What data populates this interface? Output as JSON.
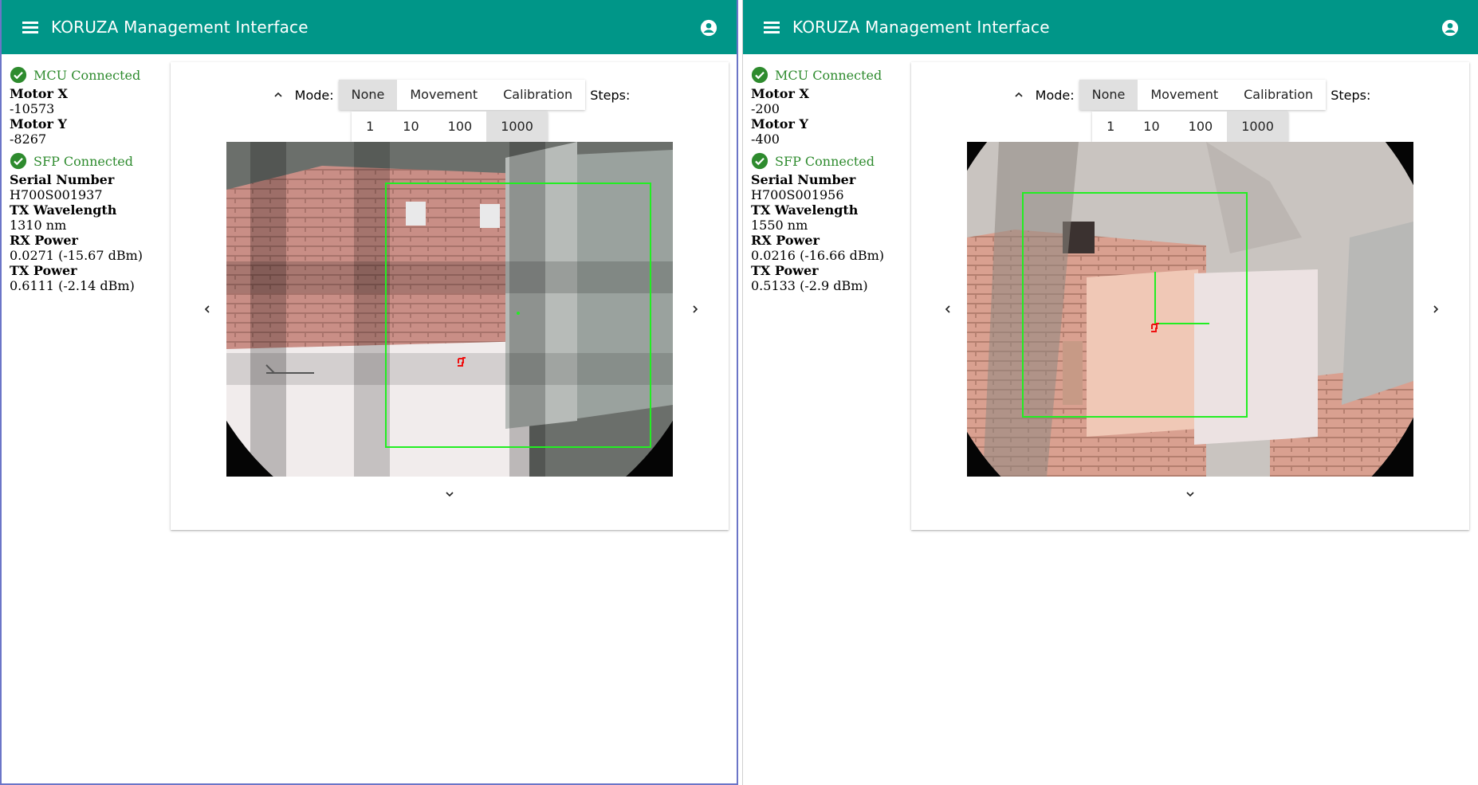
{
  "theme": {
    "primary": "#009688",
    "status_ok": "#2e8b2e",
    "aim_box": "#22ee22",
    "target": "#ee1111"
  },
  "icons": {
    "menu": "menu-icon",
    "account": "account-circle-icon",
    "status": "check-circle-icon",
    "collapse": "chevron-up-icon",
    "left": "chevron-left-icon",
    "right": "chevron-right-icon",
    "down": "chevron-down-icon"
  },
  "panels": [
    {
      "title": "KORUZA Management Interface",
      "mcu_status": "MCU Connected",
      "motor_x_label": "Motor X",
      "motor_x": "-10573",
      "motor_y_label": "Motor Y",
      "motor_y": "-8267",
      "sfp_status": "SFP Connected",
      "serial_label": "Serial Number",
      "serial": "H700S001937",
      "tx_wavelength_label": "TX Wavelength",
      "tx_wavelength": "1310 nm",
      "rx_power_label": "RX Power",
      "rx_power": "0.0271 (-15.67 dBm)",
      "tx_power_label": "TX Power",
      "tx_power": "0.6111 (-2.14 dBm)",
      "mode_label": "Mode:",
      "modes": [
        "None",
        "Movement",
        "Calibration"
      ],
      "active_mode": "None",
      "steps_label": "Steps:",
      "steps": [
        "1",
        "10",
        "100",
        "1000"
      ],
      "active_step": "1000"
    },
    {
      "title": "KORUZA Management Interface",
      "mcu_status": "MCU Connected",
      "motor_x_label": "Motor X",
      "motor_x": "-200",
      "motor_y_label": "Motor Y",
      "motor_y": "-400",
      "sfp_status": "SFP Connected",
      "serial_label": "Serial Number",
      "serial": "H700S001956",
      "tx_wavelength_label": "TX Wavelength",
      "tx_wavelength": "1550 nm",
      "rx_power_label": "RX Power",
      "rx_power": "0.0216 (-16.66 dBm)",
      "tx_power_label": "TX Power",
      "tx_power": "0.5133 (-2.9 dBm)",
      "mode_label": "Mode:",
      "modes": [
        "None",
        "Movement",
        "Calibration"
      ],
      "active_mode": "None",
      "steps_label": "Steps:",
      "steps": [
        "1",
        "10",
        "100",
        "1000"
      ],
      "active_step": "1000"
    }
  ]
}
